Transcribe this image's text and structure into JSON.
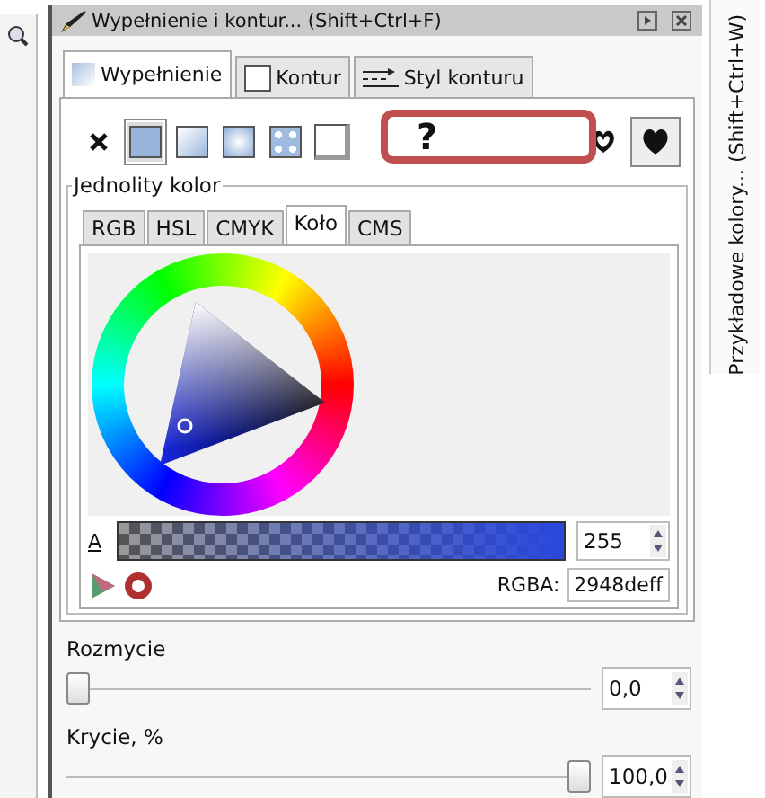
{
  "window": {
    "title": "Wypełnienie i kontur... (Shift+Ctrl+F)"
  },
  "side_tab": {
    "label": "Przykładowe kolory... (Shift+Ctrl+W)"
  },
  "fill_tabs": [
    {
      "label": "Wypełnienie",
      "kind": "fill",
      "selected": true
    },
    {
      "label": "Kontur",
      "kind": "stroke",
      "selected": false
    },
    {
      "label": "Styl konturu",
      "kind": "style",
      "selected": false
    }
  ],
  "paint_types": [
    {
      "kind": "none",
      "selected": false
    },
    {
      "kind": "flat",
      "selected": true
    },
    {
      "kind": "linear",
      "selected": false
    },
    {
      "kind": "radial",
      "selected": false
    },
    {
      "kind": "pattern",
      "selected": false
    },
    {
      "kind": "swatch",
      "selected": false
    }
  ],
  "annotation": {
    "text": "?"
  },
  "fill_rules": [
    {
      "kind": "evenodd",
      "selected": false
    },
    {
      "kind": "nonzero",
      "selected": true
    }
  ],
  "color_group": {
    "title": "Jednolity kolor"
  },
  "color_tabs": [
    {
      "label": "RGB",
      "selected": false
    },
    {
      "label": "HSL",
      "selected": false
    },
    {
      "label": "CMYK",
      "selected": false
    },
    {
      "label": "Koło",
      "selected": true
    },
    {
      "label": "CMS",
      "selected": false
    }
  ],
  "alpha": {
    "label": "A",
    "value": "255",
    "level": 1
  },
  "rgba": {
    "label": "RGBA:",
    "value": "2948deff"
  },
  "blur": {
    "label": "Rozmycie",
    "value": "0,0",
    "level": 0
  },
  "opacity": {
    "label": "Krycie, %",
    "value": "100,0",
    "level": 1
  }
}
